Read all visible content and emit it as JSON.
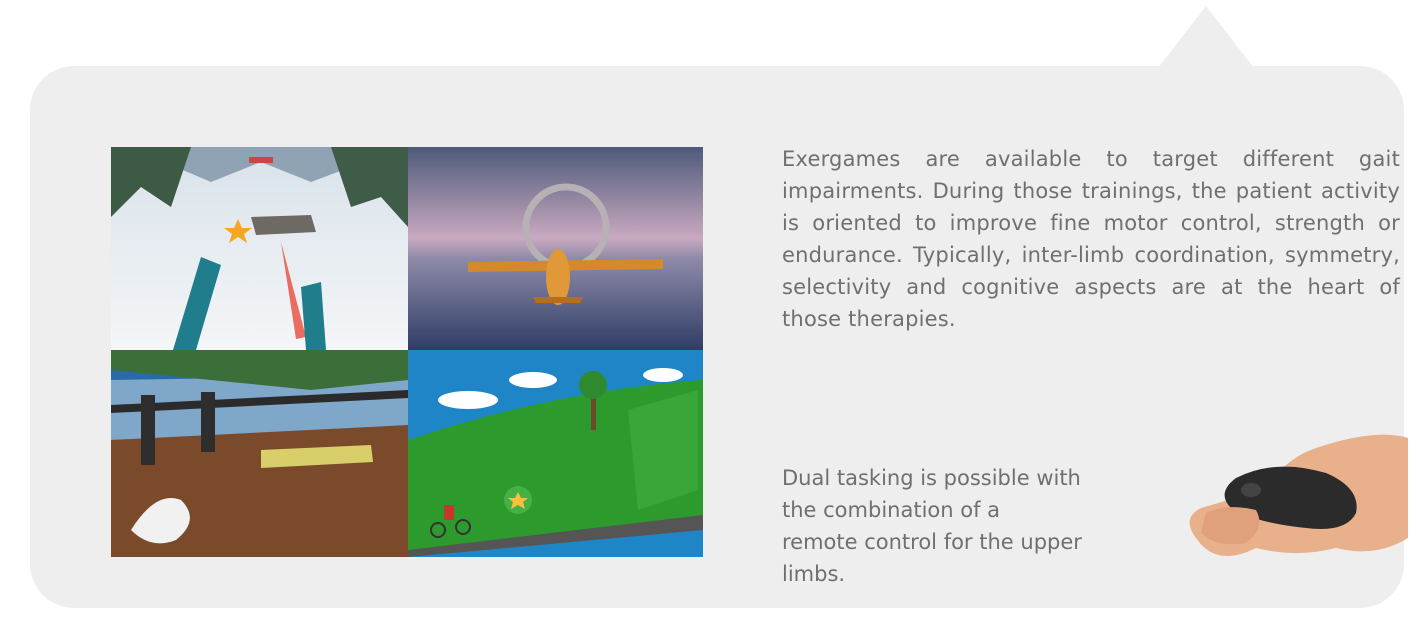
{
  "paragraphs": {
    "main": "Exergames are available to target different gait impairments. During those trainings, the patient activity is oriented to improve fine motor control, strength or endurance. Typically, inter-limb coordination, symmetry, selectivity and cognitive aspects are at the heart of those therapies.",
    "dual_tasking": "Dual tasking is possible with the combination of a remote control for the upper limbs."
  },
  "images": {
    "tiles": [
      {
        "name": "ski-game",
        "icon": "star-icon"
      },
      {
        "name": "plane-game"
      },
      {
        "name": "cat-game"
      },
      {
        "name": "bike-game",
        "icon": "star-icon"
      }
    ],
    "remote": {
      "name": "hand-remote-control"
    }
  },
  "colors": {
    "panel": "#eeeeee",
    "text": "#6f6f6f",
    "accent": "#f5a623"
  }
}
